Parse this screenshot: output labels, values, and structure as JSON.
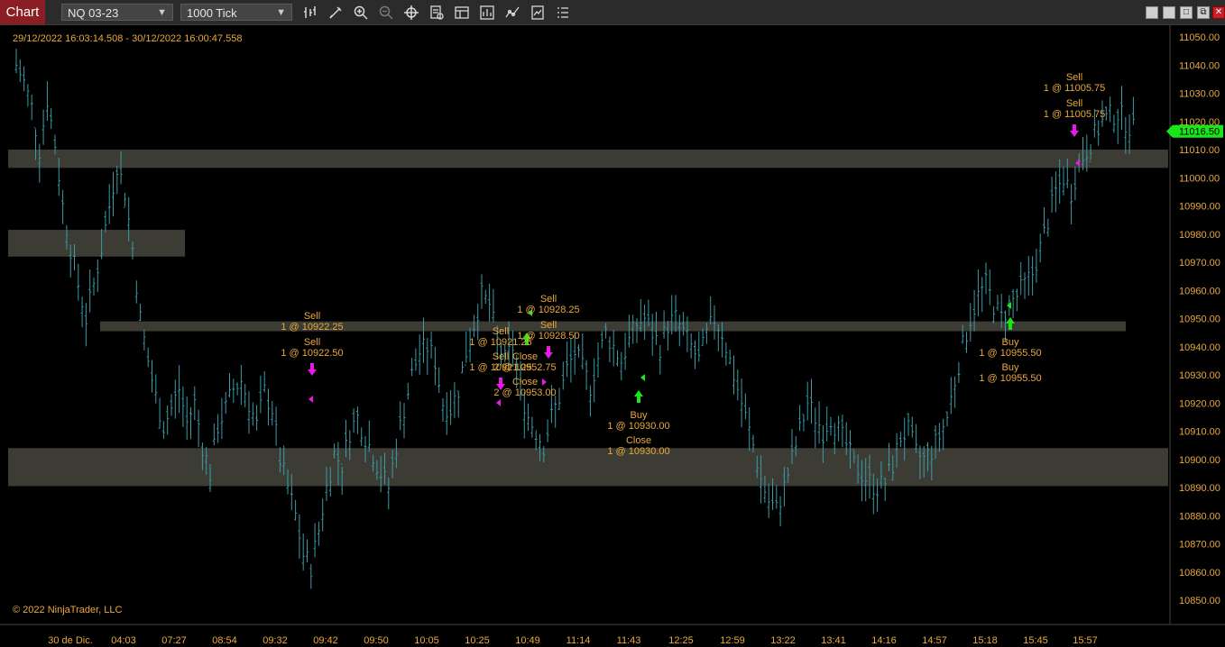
{
  "toolbar": {
    "tab_label": "Chart",
    "instrument": "NQ 03-23",
    "interval": "1000 Tick",
    "tools": [
      "bar-type-icon",
      "pencil-icon",
      "zoom-in-icon",
      "zoom-out-icon",
      "crosshair-icon",
      "properties-icon",
      "template-icon",
      "indicators-icon",
      "strategies-icon",
      "snapshot-icon",
      "list-icon"
    ],
    "window_buttons": [
      "minimize",
      "restore",
      "maximize",
      "close"
    ]
  },
  "chart": {
    "date_range": "29/12/2022 16:03:14.508 - 30/12/2022 16:00:47.558",
    "copyright": "© 2022 NinjaTrader, LLC",
    "last_price_label": "11016.50",
    "last_price": 11016.5,
    "colors": {
      "bars": "#3b9aa6",
      "zone": "#3c3c34",
      "text": "#e9a83c",
      "buy": "#19e619",
      "sell": "#e619e6",
      "axis": "#e9a83c"
    }
  },
  "chart_data": {
    "type": "line",
    "instrument": "NQ 03-23",
    "y_ticks": [
      11050.0,
      11040.0,
      11030.0,
      11020.0,
      11010.0,
      11000.0,
      10990.0,
      10980.0,
      10970.0,
      10960.0,
      10950.0,
      10940.0,
      10930.0,
      10920.0,
      10910.0,
      10900.0,
      10890.0,
      10880.0,
      10870.0,
      10860.0,
      10850.0
    ],
    "ylim": [
      10845,
      11053
    ],
    "x_labels": [
      "30 de Dic.",
      "04:03",
      "07:27",
      "08:54",
      "09:32",
      "09:42",
      "09:50",
      "10:05",
      "10:25",
      "10:49",
      "11:14",
      "11:43",
      "12:25",
      "12:59",
      "13:22",
      "13:41",
      "14:16",
      "14:57",
      "15:18",
      "15:45",
      "15:57"
    ],
    "price_path": [
      [
        0,
        11040
      ],
      [
        2,
        11034
      ],
      [
        4,
        11025
      ],
      [
        6,
        11010
      ],
      [
        8,
        11028
      ],
      [
        10,
        11012
      ],
      [
        12,
        10990
      ],
      [
        14,
        10975
      ],
      [
        16,
        10962
      ],
      [
        18,
        10950
      ],
      [
        20,
        10962
      ],
      [
        22,
        10975
      ],
      [
        24,
        10990
      ],
      [
        26,
        11005
      ],
      [
        28,
        10995
      ],
      [
        30,
        10975
      ],
      [
        32,
        10950
      ],
      [
        34,
        10935
      ],
      [
        36,
        10922
      ],
      [
        38,
        10912
      ],
      [
        40,
        10918
      ],
      [
        42,
        10925
      ],
      [
        44,
        10913
      ],
      [
        46,
        10920
      ],
      [
        48,
        10905
      ],
      [
        50,
        10895
      ],
      [
        52,
        10912
      ],
      [
        54,
        10918
      ],
      [
        56,
        10925
      ],
      [
        58,
        10928
      ],
      [
        60,
        10920
      ],
      [
        62,
        10912
      ],
      [
        64,
        10924
      ],
      [
        66,
        10918
      ],
      [
        68,
        10900
      ],
      [
        70,
        10890
      ],
      [
        72,
        10880
      ],
      [
        74,
        10866
      ],
      [
        76,
        10862
      ],
      [
        78,
        10875
      ],
      [
        80,
        10890
      ],
      [
        82,
        10902
      ],
      [
        84,
        10898
      ],
      [
        86,
        10910
      ],
      [
        88,
        10915
      ],
      [
        90,
        10908
      ],
      [
        92,
        10902
      ],
      [
        94,
        10895
      ],
      [
        96,
        10890
      ],
      [
        98,
        10905
      ],
      [
        100,
        10918
      ],
      [
        102,
        10930
      ],
      [
        104,
        10938
      ],
      [
        106,
        10940
      ],
      [
        108,
        10935
      ],
      [
        110,
        10920
      ],
      [
        112,
        10918
      ],
      [
        114,
        10925
      ],
      [
        116,
        10938
      ],
      [
        118,
        10948
      ],
      [
        120,
        10958
      ],
      [
        122,
        10955
      ],
      [
        124,
        10942
      ],
      [
        126,
        10935
      ],
      [
        128,
        10940
      ],
      [
        130,
        10925
      ],
      [
        132,
        10915
      ],
      [
        134,
        10910
      ],
      [
        136,
        10905
      ],
      [
        138,
        10915
      ],
      [
        140,
        10922
      ],
      [
        142,
        10932
      ],
      [
        144,
        10938
      ],
      [
        146,
        10932
      ],
      [
        148,
        10926
      ],
      [
        150,
        10936
      ],
      [
        152,
        10945
      ],
      [
        154,
        10940
      ],
      [
        156,
        10935
      ],
      [
        158,
        10942
      ],
      [
        160,
        10948
      ],
      [
        162,
        10950
      ],
      [
        164,
        10945
      ],
      [
        166,
        10940
      ],
      [
        168,
        10948
      ],
      [
        170,
        10950
      ],
      [
        172,
        10945
      ],
      [
        174,
        10940
      ],
      [
        176,
        10935
      ],
      [
        178,
        10944
      ],
      [
        180,
        10950
      ],
      [
        182,
        10945
      ],
      [
        184,
        10935
      ],
      [
        186,
        10925
      ],
      [
        188,
        10915
      ],
      [
        190,
        10905
      ],
      [
        192,
        10893
      ],
      [
        194,
        10885
      ],
      [
        196,
        10882
      ],
      [
        198,
        10890
      ],
      [
        200,
        10900
      ],
      [
        202,
        10910
      ],
      [
        204,
        10920
      ],
      [
        206,
        10915
      ],
      [
        208,
        10910
      ],
      [
        210,
        10915
      ],
      [
        212,
        10910
      ],
      [
        214,
        10905
      ],
      [
        216,
        10898
      ],
      [
        218,
        10895
      ],
      [
        220,
        10892
      ],
      [
        222,
        10890
      ],
      [
        224,
        10892
      ],
      [
        226,
        10898
      ],
      [
        228,
        10908
      ],
      [
        230,
        10910
      ],
      [
        232,
        10902
      ],
      [
        234,
        10900
      ],
      [
        236,
        10903
      ],
      [
        238,
        10908
      ],
      [
        240,
        10915
      ],
      [
        242,
        10928
      ],
      [
        244,
        10940
      ],
      [
        246,
        10950
      ],
      [
        248,
        10958
      ],
      [
        250,
        10962
      ],
      [
        252,
        10955
      ],
      [
        254,
        10950
      ],
      [
        256,
        10955
      ],
      [
        258,
        10958
      ],
      [
        260,
        10962
      ],
      [
        262,
        10966
      ],
      [
        264,
        10975
      ],
      [
        266,
        10985
      ],
      [
        268,
        10995
      ],
      [
        270,
        11000
      ],
      [
        272,
        10995
      ],
      [
        274,
        11005
      ],
      [
        276,
        11010
      ],
      [
        278,
        11015
      ],
      [
        280,
        11020
      ],
      [
        282,
        11022
      ],
      [
        284,
        11023
      ],
      [
        286,
        11020
      ],
      [
        288,
        11017
      ]
    ],
    "zones": [
      {
        "from": 11003.5,
        "to": 11010
      },
      {
        "from": 10972,
        "to": 10981.5
      },
      {
        "from": 10945.5,
        "to": 10949
      },
      {
        "from": 10890.5,
        "to": 10904
      }
    ],
    "executions": [
      {
        "label": "Sell",
        "detail": "1 @ 10922.25",
        "side": "sell"
      },
      {
        "label": "Sell",
        "detail": "1 @ 10922.50",
        "side": "sell"
      },
      {
        "label": "Sell",
        "detail": "1 @ 10921.25",
        "side": "sell"
      },
      {
        "label": "Sell",
        "detail": "1 @ 10928.25",
        "side": "sell"
      },
      {
        "label": "Sell",
        "detail": "1 @ 10928.50",
        "side": "sell"
      },
      {
        "label": "Sell",
        "detail": "1 @ 10921.25",
        "side": "sell"
      },
      {
        "label": "Close",
        "detail": "2 @ 10952.75",
        "side": "close"
      },
      {
        "label": "Close",
        "detail": "2 @ 10953.00",
        "side": "close"
      },
      {
        "label": "Buy",
        "detail": "1 @ 10930.00",
        "side": "buy"
      },
      {
        "label": "Close",
        "detail": "1 @ 10930.00",
        "side": "close"
      },
      {
        "label": "Buy",
        "detail": "1 @ 10955.50",
        "side": "buy"
      },
      {
        "label": "Buy",
        "detail": "1 @ 10955.50",
        "side": "buy"
      },
      {
        "label": "Sell",
        "detail": "1 @ 11005.75",
        "side": "sell"
      },
      {
        "label": "Sell",
        "detail": "1 @ 11005.75",
        "side": "sell"
      }
    ]
  }
}
